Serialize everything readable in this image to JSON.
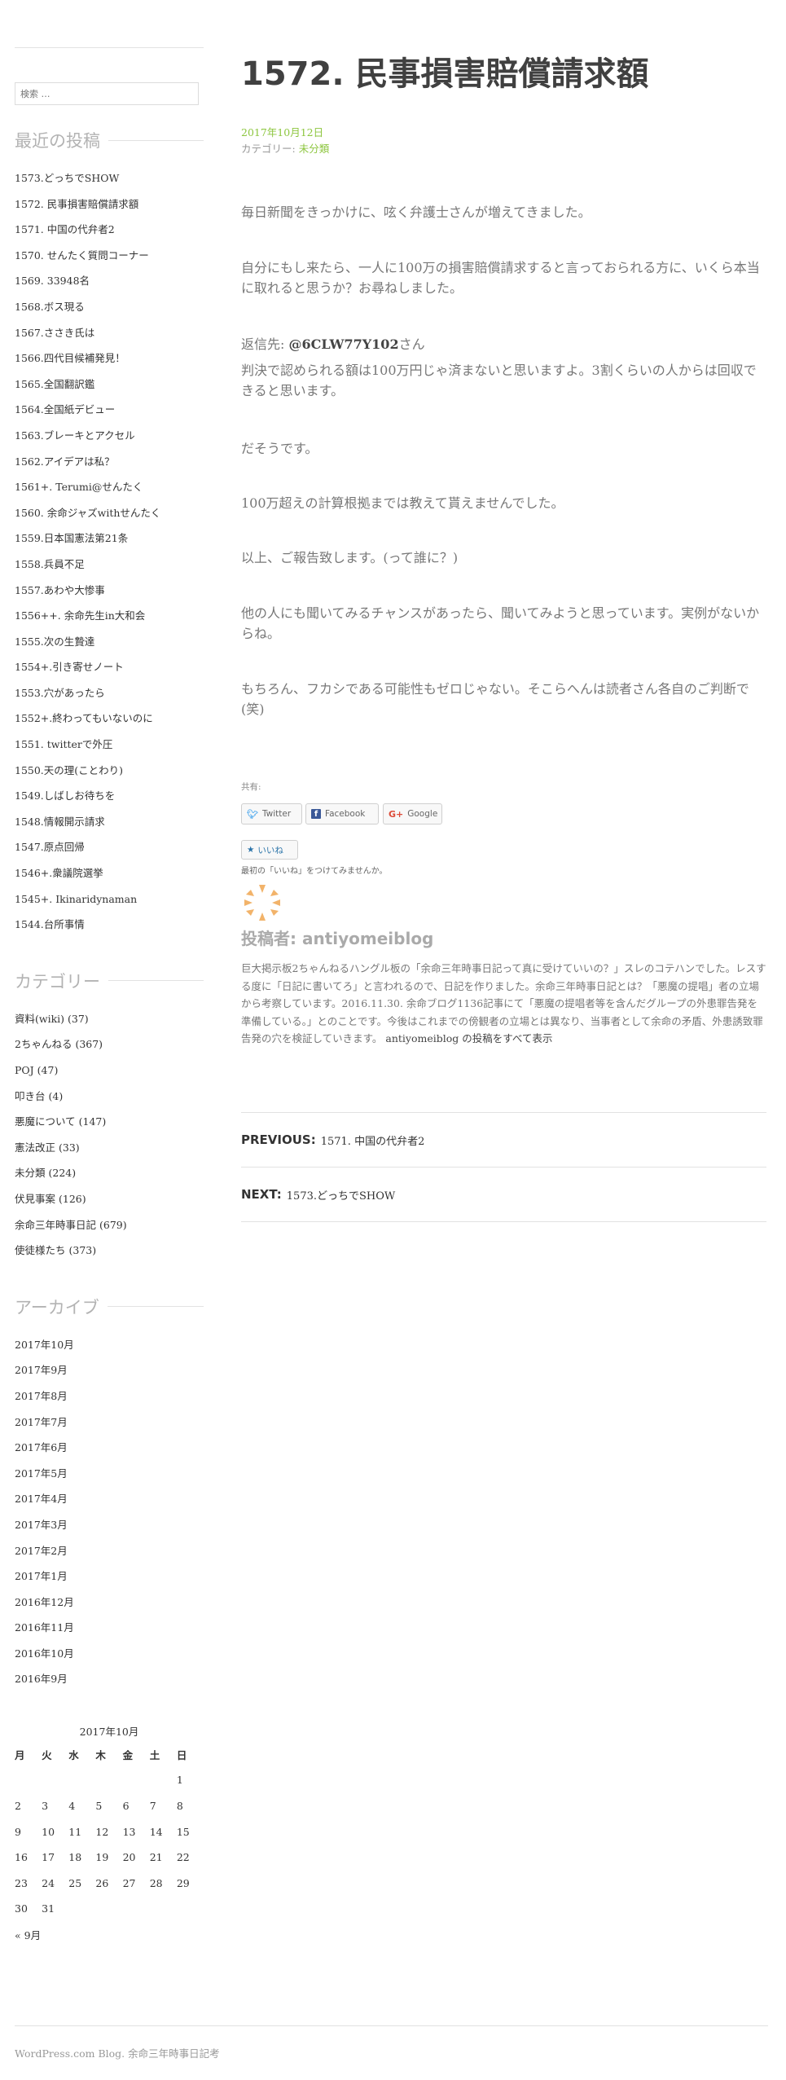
{
  "search": {
    "placeholder": "検索 …"
  },
  "sidebar": {
    "recent_title": "最近の投稿",
    "recent_posts": [
      "1573.どっちでSHOW",
      "1572. 民事損害賠償請求額",
      "1571. 中国の代弁者2",
      "1570. せんたく質問コーナー",
      "1569. 33948名",
      "1568.ボス現る",
      "1567.ささき氏は",
      "1566.四代目候補発見！",
      "1565.全国翻訳鑑",
      "1564.全国紙デビュー",
      "1563.ブレーキとアクセル",
      "1562.アイデアは私？",
      "1561+. Terumi@せんたく",
      "1560. 余命ジャズwithせんたく",
      "1559.日本国憲法第21条",
      "1558.兵員不足",
      "1557.あわや大惨事",
      "1556++. 余命先生in大和会",
      "1555.次の生贄達",
      "1554+.引き寄せノート",
      "1553.穴があったら",
      "1552+.終わってもいないのに",
      "1551. twitterで外圧",
      "1550.天の理(ことわり)",
      "1549.しばしお待ちを",
      "1548.情報開示請求",
      "1547.原点回帰",
      "1546+.衆議院選挙",
      "1545+. Ikinaridynaman",
      "1544.台所事情"
    ],
    "categories_title": "カテゴリー",
    "categories": [
      {
        "name": "資料(wiki)",
        "count": "(37)"
      },
      {
        "name": "2ちゃんねる",
        "count": "(367)"
      },
      {
        "name": "POJ",
        "count": "(47)"
      },
      {
        "name": "叩き台",
        "count": "(4)"
      },
      {
        "name": "悪魔について",
        "count": "(147)"
      },
      {
        "name": "憲法改正",
        "count": "(33)"
      },
      {
        "name": "未分類",
        "count": "(224)"
      },
      {
        "name": "伏見事案",
        "count": "(126)"
      },
      {
        "name": "余命三年時事日記",
        "count": "(679)"
      },
      {
        "name": "使徒様たち",
        "count": "(373)"
      }
    ],
    "archives_title": "アーカイブ",
    "archives": [
      "2017年10月",
      "2017年9月",
      "2017年8月",
      "2017年7月",
      "2017年6月",
      "2017年5月",
      "2017年4月",
      "2017年3月",
      "2017年2月",
      "2017年1月",
      "2016年12月",
      "2016年11月",
      "2016年10月",
      "2016年9月"
    ],
    "calendar": {
      "caption": "2017年10月",
      "weekdays": [
        "月",
        "火",
        "水",
        "木",
        "金",
        "土",
        "日"
      ],
      "weeks": [
        [
          "",
          "",
          "",
          "",
          "",
          "",
          "1"
        ],
        [
          "2",
          "3",
          "4",
          "5",
          "6",
          "7",
          "8"
        ],
        [
          "9",
          "10",
          "11",
          "12",
          "13",
          "14",
          "15"
        ],
        [
          "16",
          "17",
          "18",
          "19",
          "20",
          "21",
          "22"
        ],
        [
          "23",
          "24",
          "25",
          "26",
          "27",
          "28",
          "29"
        ],
        [
          "30",
          "31",
          "",
          "",
          "",
          "",
          ""
        ]
      ],
      "prev_link": "« 9月"
    }
  },
  "post": {
    "title": "1572. 民事損害賠償請求額",
    "date": "2017年10月12日",
    "category_label": "カテゴリー:",
    "category": "未分類",
    "paragraphs": [
      "毎日新聞をきっかけに、呟く弁護士さんが増えてきました。",
      "自分にもし来たら、一人に100万の損害賠償請求すると言っておられる方に、いくら本当に取れると思うか？お尋ねしました。",
      "判決で認められる額は100万円じゃ済まないと思いますよ。3割くらいの人からは回収できると思います。",
      "だそうです。",
      "100万超えの計算根拠までは教えて貰えませんでした。",
      "以上、ご報告致します。(って誰に？)",
      "他の人にも聞いてみるチャンスがあったら、聞いてみようと思っています。実例がないからね。",
      "もちろん、フカシである可能性もゼロじゃない。そこらへんは読者さん各自のご判断で(笑)"
    ],
    "reply_prefix": "返信先: ",
    "reply_handle": "@6CLW77Y102",
    "reply_suffix": "さん"
  },
  "share": {
    "label": "共有:",
    "twitter": "Twitter",
    "facebook": "Facebook",
    "google": "Google"
  },
  "like": {
    "label": "いいね",
    "note": "最初の「いいね」をつけてみませんか。"
  },
  "author": {
    "heading": "投稿者: antiyomeiblog",
    "bio": "巨大掲示板2ちゃんねるハングル板の「余命三年時事日記って真に受けていいの？」スレのコテハンでした。レスする度に「日記に書いてろ」と言われるので、日記を作りました。余命三年時事日記とは？「悪魔の提唱」者の立場から考察しています。2016.11.30. 余命ブログ1136記事にて「悪魔の提唱者等を含んだグループの外患罪告発を準備している。」とのことです。今後はこれまでの傍観者の立場とは異なり、当事者として余命の矛盾、外患誘致罪告発の穴を検証していきます。",
    "all_posts_link": "antiyomeiblog の投稿をすべて表示"
  },
  "nav": {
    "previous_key": "PREVIOUS:",
    "previous_title": "1571. 中国の代弁者2",
    "next_key": "NEXT:",
    "next_title": "1573.どっちでSHOW"
  },
  "footer": {
    "credit": "WordPress.com Blog.",
    "site": "余命三年時事日記考"
  },
  "colors": {
    "accent": "#8dc63f",
    "heading_gray": "#b3b3b3",
    "body_text": "#777777"
  }
}
